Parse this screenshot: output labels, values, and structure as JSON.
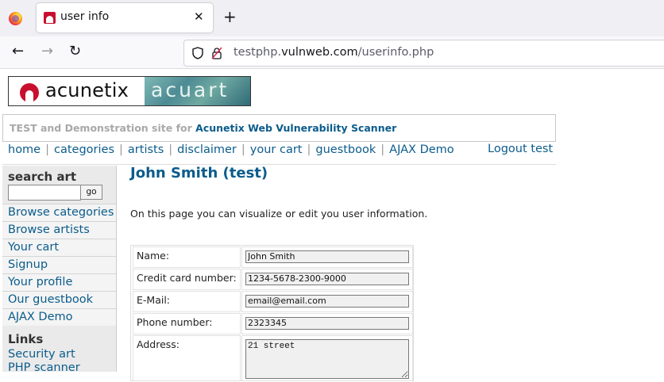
{
  "browser": {
    "tab_title": "user info",
    "tab_close": "✕",
    "new_tab": "+",
    "url_prefix": "testphp.",
    "url_domain": "vulnweb.com",
    "url_path": "/userinfo.php"
  },
  "logo": {
    "left": "acunetix",
    "right": "acuart"
  },
  "tagline": {
    "prefix": "TEST and Demonstration site for ",
    "highlight": "Acunetix Web Vulnerability Scanner"
  },
  "topmenu": {
    "items": [
      "home",
      "categories",
      "artists",
      "disclaimer",
      "your cart",
      "guestbook",
      "AJAX Demo"
    ],
    "logout": "Logout test"
  },
  "sidebar": {
    "search_title": "search art",
    "search_value": "",
    "go_label": "go",
    "items": [
      "Browse categories",
      "Browse artists",
      "Your cart",
      "Signup",
      "Your profile",
      "Our guestbook",
      "AJAX Demo"
    ],
    "links_title": "Links",
    "links": [
      "Security art",
      "PHP scanner"
    ]
  },
  "content": {
    "title": "John Smith (test)",
    "intro": "On this page you can visualize or edit you user information.",
    "fields": [
      {
        "label": "Name:",
        "value": "John Smith"
      },
      {
        "label": "Credit card number:",
        "value": "1234-5678-2300-9000"
      },
      {
        "label": "E-Mail:",
        "value": "email@email.com"
      },
      {
        "label": "Phone number:",
        "value": "2323345"
      },
      {
        "label": "Address:",
        "value": "21 street"
      }
    ]
  },
  "colors": {
    "link": "#0b5c8c",
    "brand_red": "#c8102e"
  }
}
